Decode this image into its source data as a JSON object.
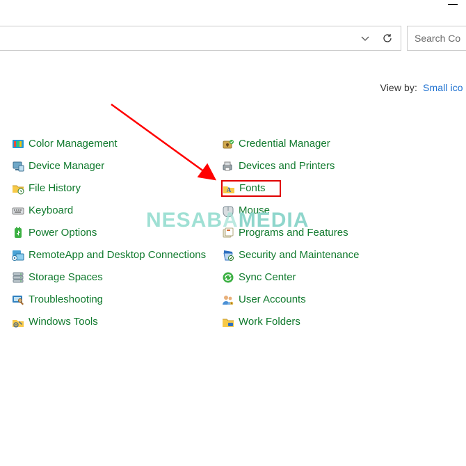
{
  "window": {
    "minimize_hint": "minimize"
  },
  "addressbar": {
    "dropdown_hint": "history",
    "refresh_hint": "refresh"
  },
  "search": {
    "placeholder": "Search Co"
  },
  "viewby": {
    "label": "View by:",
    "value": "Small ico"
  },
  "columns": {
    "left": [
      {
        "key": "color-management",
        "label": "Color Management",
        "icon": "color-mgmt"
      },
      {
        "key": "device-manager",
        "label": "Device Manager",
        "icon": "device-mgr"
      },
      {
        "key": "file-history",
        "label": "File History",
        "icon": "file-history"
      },
      {
        "key": "keyboard",
        "label": "Keyboard",
        "icon": "keyboard"
      },
      {
        "key": "power-options",
        "label": "Power Options",
        "icon": "power"
      },
      {
        "key": "remoteapp",
        "label": "RemoteApp and Desktop Connections",
        "icon": "remoteapp"
      },
      {
        "key": "storage-spaces",
        "label": "Storage Spaces",
        "icon": "storage"
      },
      {
        "key": "troubleshooting",
        "label": "Troubleshooting",
        "icon": "troubleshoot"
      },
      {
        "key": "windows-tools",
        "label": "Windows Tools",
        "icon": "tools"
      }
    ],
    "right": [
      {
        "key": "credential-manager",
        "label": "Credential Manager",
        "icon": "credential"
      },
      {
        "key": "devices-printers",
        "label": "Devices and Printers",
        "icon": "devices-printers"
      },
      {
        "key": "fonts",
        "label": "Fonts",
        "icon": "fonts",
        "highlight": true
      },
      {
        "key": "mouse",
        "label": "Mouse",
        "icon": "mouse"
      },
      {
        "key": "programs-features",
        "label": "Programs and Features",
        "icon": "programs"
      },
      {
        "key": "security-maintenance",
        "label": "Security and Maintenance",
        "icon": "security"
      },
      {
        "key": "sync-center",
        "label": "Sync Center",
        "icon": "sync"
      },
      {
        "key": "user-accounts",
        "label": "User Accounts",
        "icon": "users"
      },
      {
        "key": "work-folders",
        "label": "Work Folders",
        "icon": "work-folders"
      }
    ]
  },
  "annotations": {
    "arrow_color": "#ff0000",
    "highlight_color": "#e00000",
    "watermark_text": "NESABAMEDIA"
  }
}
